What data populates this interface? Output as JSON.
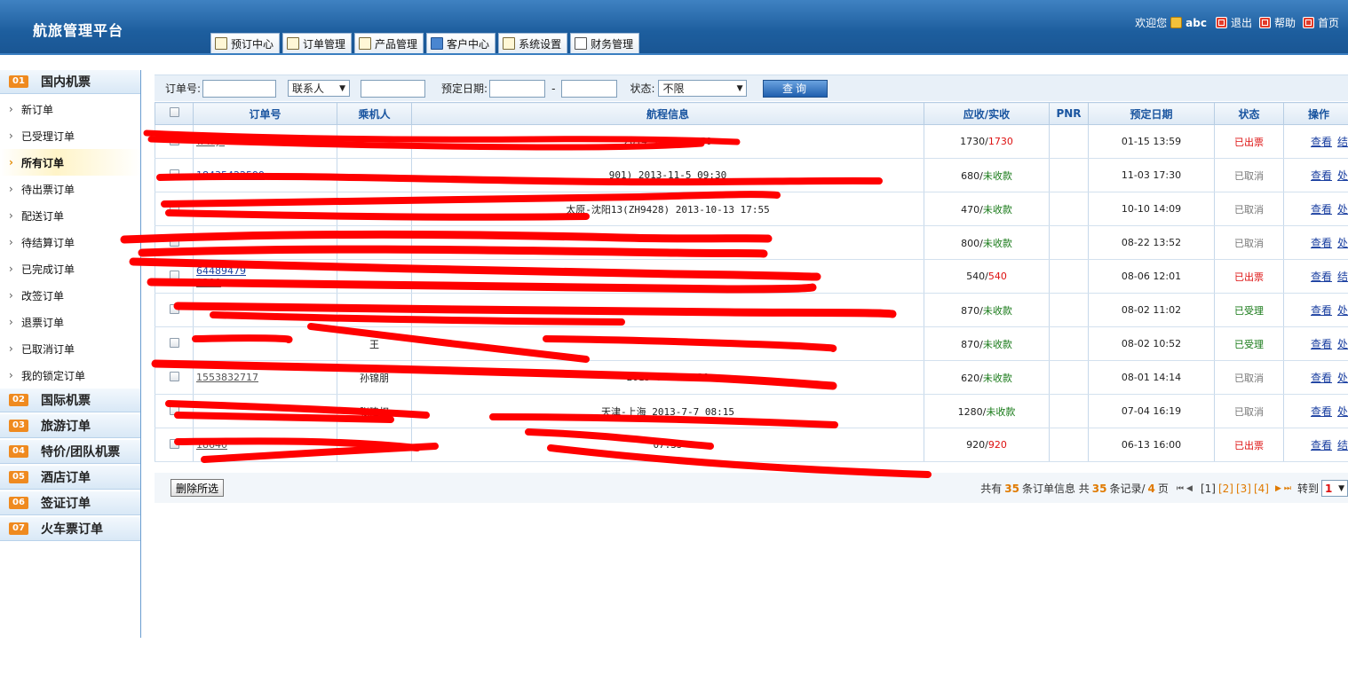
{
  "header": {
    "brand": "航旅管理平台",
    "welcome": "欢迎您",
    "username": "abc",
    "logout": "退出",
    "help": "帮助",
    "home": "首页"
  },
  "tabs": [
    "预订中心",
    "订单管理",
    "产品管理",
    "客户中心",
    "系统设置",
    "财务管理"
  ],
  "sidebar": {
    "domestic": {
      "num": "01",
      "label": "国内机票"
    },
    "items": [
      "新订单",
      "已受理订单",
      "所有订单",
      "待出票订单",
      "配送订单",
      "待结算订单",
      "已完成订单",
      "改签订单",
      "退票订单",
      "已取消订单",
      "我的锁定订单"
    ],
    "active_item": "所有订单",
    "sections": [
      {
        "num": "02",
        "label": "国际机票"
      },
      {
        "num": "03",
        "label": "旅游订单"
      },
      {
        "num": "04",
        "label": "特价/团队机票"
      },
      {
        "num": "05",
        "label": "酒店订单"
      },
      {
        "num": "06",
        "label": "签证订单"
      },
      {
        "num": "07",
        "label": "火车票订单"
      }
    ]
  },
  "filters": {
    "order_no_label": "订单号:",
    "contact_select": "联系人",
    "date_label": "预定日期:",
    "dash": "-",
    "status_label": "状态:",
    "status_select": "不限",
    "query_button": "查询"
  },
  "table": {
    "headers": {
      "order_no": "订单号",
      "passenger": "乘机人",
      "route": "航程信息",
      "amount": "应收/实收",
      "pnr": "PNR",
      "date": "预定日期",
      "status": "状态",
      "ops": "操作"
    },
    "rows": [
      {
        "ord1": "",
        "ord2": "w x j i",
        "pax": "",
        "route": "2014-1-19 10:50",
        "due": "1730",
        "paid": "1730",
        "paid_type": "red",
        "date": "01-15 13:59",
        "status": "已出票",
        "status_type": "red",
        "op1": "查看",
        "op2": "结"
      },
      {
        "ord1": "18435422599",
        "ord2": "",
        "pax": "",
        "route": "901) 2013-11-5 09:30",
        "due": "680",
        "paid": "未收款",
        "paid_type": "grn",
        "date": "11-03 17:30",
        "status": "已取消",
        "status_type": "gry",
        "op1": "查看",
        "op2": "处"
      },
      {
        "ord1": "",
        "ord2": "",
        "pax": "",
        "route": "太原-沈阳13(ZH9428) 2013-10-13 17:55",
        "due": "470",
        "paid": "未收款",
        "paid_type": "grn",
        "date": "10-10 14:09",
        "status": "已取消",
        "status_type": "gry",
        "op1": "查看",
        "op2": "处"
      },
      {
        "ord1": "",
        "ord2": "",
        "pax": "",
        "route": "",
        "due": "800",
        "paid": "未收款",
        "paid_type": "grn",
        "date": "08-22 13:52",
        "status": "已取消",
        "status_type": "gry",
        "op1": "查看",
        "op2": "处"
      },
      {
        "ord1": "64489479",
        "ord2": "1300",
        "pax": "",
        "route": "",
        "due": "540",
        "paid": "540",
        "paid_type": "red",
        "date": "08-06 12:01",
        "status": "已出票",
        "status_type": "red",
        "op1": "查看",
        "op2": "结"
      },
      {
        "ord1": "",
        "ord2": "",
        "pax": "",
        "route": "",
        "due": "870",
        "paid": "未收款",
        "paid_type": "grn",
        "date": "08-02 11:02",
        "status": "已受理",
        "status_type": "grn",
        "op1": "查看",
        "op2": "处"
      },
      {
        "ord1": "",
        "ord2": "",
        "pax": "王",
        "route": "",
        "due": "870",
        "paid": "未收款",
        "paid_type": "grn",
        "date": "08-02 10:52",
        "status": "已受理",
        "status_type": "grn",
        "op1": "查看",
        "op2": "处"
      },
      {
        "ord1": "",
        "ord2": "1553832717",
        "pax": "孙锦朋",
        "route": "2013-8-2 19:30",
        "due": "620",
        "paid": "未收款",
        "paid_type": "grn",
        "date": "08-01 14:14",
        "status": "已取消",
        "status_type": "gry",
        "op1": "查看",
        "op2": "处"
      },
      {
        "ord1": "",
        "ord2": "",
        "pax": "张建权",
        "route": "天津-上海 2013-7-7 08:15",
        "due": "1280",
        "paid": "未收款",
        "paid_type": "grn",
        "date": "07-04 16:19",
        "status": "已取消",
        "status_type": "gry",
        "op1": "查看",
        "op2": "处"
      },
      {
        "ord1": "",
        "ord2": "18640",
        "pax": "",
        "route": "07:35",
        "due": "920",
        "paid": "920",
        "paid_type": "red",
        "date": "06-13 16:00",
        "status": "已出票",
        "status_type": "red",
        "op1": "查看",
        "op2": "结"
      }
    ]
  },
  "footer": {
    "delete_button": "删除所选",
    "total_prefix": "共有",
    "total_orders": "35",
    "total_mid": "条订单信息 共",
    "total_records": "35",
    "records_suffix": "条记录/",
    "total_pages": "4",
    "pages_suffix": "页",
    "pages": [
      "[1]",
      "[2]",
      "[3]",
      "[4]"
    ],
    "goto_label": "转到",
    "goto_value": "1"
  },
  "colors": {
    "header_blue": "#1d5e9e",
    "accent_orange": "#ef8a1f",
    "status_red": "#dd1111",
    "status_green": "#187a18"
  }
}
